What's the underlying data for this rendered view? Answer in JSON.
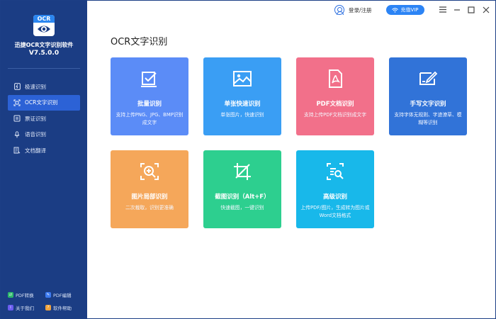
{
  "app": {
    "logo_text": "OCR",
    "name": "迅捷OCR文字识别软件",
    "version": "V7.5.0.0"
  },
  "sidebar": {
    "items": [
      {
        "label": "极速识别",
        "icon": "lightning-icon",
        "active": false
      },
      {
        "label": "OCR文字识别",
        "icon": "ocr-icon",
        "active": true
      },
      {
        "label": "票证识别",
        "icon": "ticket-icon",
        "active": false
      },
      {
        "label": "语音识别",
        "icon": "microphone-icon",
        "active": false
      },
      {
        "label": "文档翻译",
        "icon": "translate-icon",
        "active": false
      }
    ],
    "bottom_links": [
      {
        "label": "PDF转换",
        "color": "#2db86b"
      },
      {
        "label": "PDF编辑",
        "color": "#3d7bf0"
      },
      {
        "label": "关于我们",
        "color": "#6b5df0"
      },
      {
        "label": "软件帮助",
        "color": "#f0a33d"
      }
    ]
  },
  "titlebar": {
    "login_label": "登录/注册",
    "vip_label": "充值VIP"
  },
  "main": {
    "title": "OCR文字识别",
    "cards": [
      {
        "title": "批量识别",
        "desc": "支持上传PNG、JPG、BMP识别成文字",
        "color": "#5b8cf7",
        "icon": "batch-icon"
      },
      {
        "title": "单张快速识别",
        "desc": "单张图片，快速识别",
        "color": "#3a9ef4",
        "icon": "image-icon"
      },
      {
        "title": "PDF文档识别",
        "desc": "支持上传PDF文档识别成文字",
        "color": "#f2708a",
        "icon": "pdf-icon"
      },
      {
        "title": "手写文字识别",
        "desc": "支持字体无规则、字迹潦草、模糊等识别",
        "color": "#3173d8",
        "icon": "handwriting-icon"
      },
      {
        "title": "图片局部识别",
        "desc": "二次裁取，识别更准确",
        "color": "#f5a75a",
        "icon": "zoom-region-icon"
      },
      {
        "title": "截图识别（Alt+F）",
        "desc": "快速截图，一键识别",
        "color": "#2dcf8f",
        "icon": "crop-icon"
      },
      {
        "title": "高级识别",
        "desc": "上传PDF/图片，生成转为图片或Word文档格式",
        "color": "#18b8ea",
        "icon": "advanced-search-icon"
      }
    ]
  }
}
